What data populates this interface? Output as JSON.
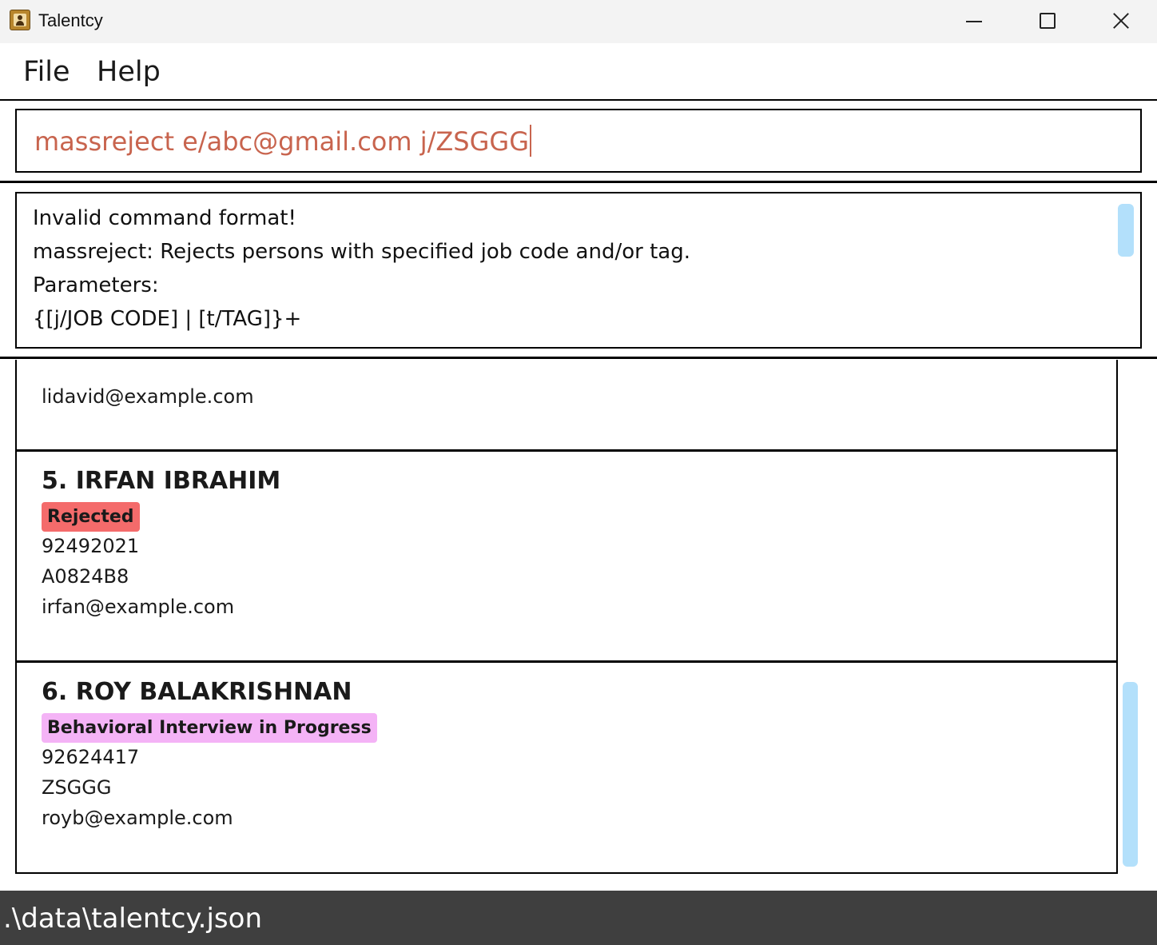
{
  "window": {
    "title": "Talentcy",
    "icon": "address-book-icon"
  },
  "menu": {
    "items": [
      {
        "label": "File"
      },
      {
        "label": "Help"
      }
    ]
  },
  "command": {
    "value": "massreject e/abc@gmail.com j/ZSGGG"
  },
  "result": {
    "lines": [
      "Invalid command format!",
      "massreject: Rejects persons with specified job code and/or tag.",
      "Parameters:",
      "{[j/JOB CODE] | [t/TAG]}+"
    ]
  },
  "persons": [
    {
      "email": "lidavid@example.com"
    },
    {
      "name": "5. IRFAN IBRAHIM",
      "status": "Rejected",
      "status_color": "#f46b6b",
      "phone": "92492021",
      "job_code": "A0824B8",
      "email": "irfan@example.com"
    },
    {
      "name": "6. ROY BALAKRISHNAN",
      "status": "Behavioral Interview in Progress",
      "status_color": "#f4b3f6",
      "phone": "92624417",
      "job_code": "ZSGGG",
      "email": "royb@example.com"
    }
  ],
  "status_bar": {
    "path": ".\\data\\talentcy.json"
  },
  "colors": {
    "command_text": "#c8644e",
    "scrollbar": "#b3e0fb",
    "status_bar_bg": "#3f3f3f"
  }
}
